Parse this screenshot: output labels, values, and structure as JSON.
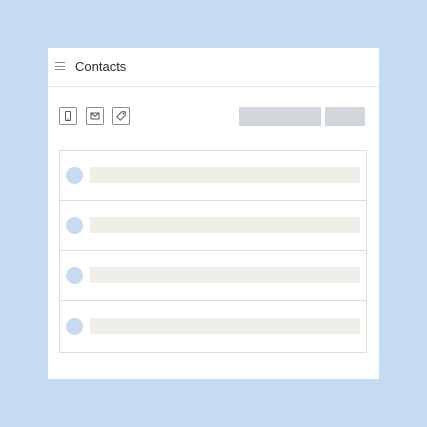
{
  "app": {
    "title": "Contacts"
  },
  "icons": {
    "menu": "menu-icon",
    "mobile": "mobile-phone-icon",
    "email": "envelope-icon",
    "tag": "tag-icon"
  },
  "contacts": {
    "rows": [
      {
        "avatar": "placeholder",
        "name": ""
      },
      {
        "avatar": "placeholder",
        "name": ""
      },
      {
        "avatar": "placeholder",
        "name": ""
      },
      {
        "avatar": "placeholder",
        "name": ""
      }
    ]
  },
  "colors": {
    "background": "#c6dbf2",
    "panel": "#ffffff",
    "skeleton_bar": "#efeee9",
    "skeleton_button": "#d1d6dd",
    "avatar": "#c6dbf2"
  }
}
